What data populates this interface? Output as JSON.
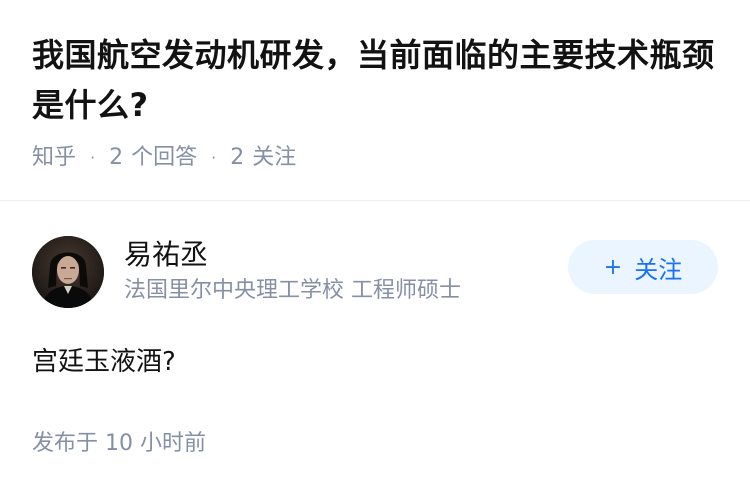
{
  "question": {
    "title": "我国航空发动机研发，当前面临的主要技术瓶颈是什么?",
    "source": "知乎",
    "answer_count": "2",
    "answer_label": "个回答",
    "follow_count": "2",
    "follow_label": "关注"
  },
  "answer": {
    "author_name": "易祐丞",
    "author_headline": "法国里尔中央理工学校 工程师硕士",
    "follow_button_label": "关注",
    "content": "宫廷玉液酒?",
    "published": "发布于 10 小时前"
  },
  "icons": {
    "follow": "plus-icon",
    "avatar": "author-avatar-photo"
  },
  "colors": {
    "title": "#121212",
    "meta": "#8590a6",
    "brand_blue": "#1772f6",
    "follow_bg": "#ebf5ff"
  }
}
